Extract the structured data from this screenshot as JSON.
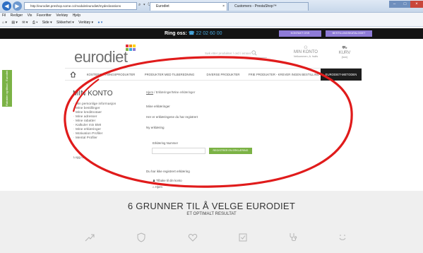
{
  "browser": {
    "address": "http://eurodiet.preshop.some.cc/module/eurodiet/mydeclarations",
    "tabs": [
      {
        "label": "Eurodiet",
        "active": true
      },
      {
        "label": "Customers - PrestaShop™",
        "active": false
      }
    ],
    "menu": [
      "Fil",
      "Rediger",
      "Vis",
      "Favoritter",
      "Verktøy",
      "Hjelp"
    ],
    "commands": [
      "Side ▾",
      "Sikkerhet ▾",
      "Verktøy ▾"
    ]
  },
  "topbar": {
    "ring_label": "Ring oss:",
    "phone": "22 02 60 00",
    "buttons": [
      "KONTAKT OSS",
      "BESTILLINGSKATALOGET"
    ]
  },
  "header": {
    "logo": "eurodiet",
    "search_placeholder": "Søk etter produkter / ord / emner",
    "account_title": "MIN KONTO",
    "account_sub": "Velkommen, A. fsdfs",
    "cart_title": "KURV",
    "cart_sub": "(tom)"
  },
  "side_tab": "Rabatter og tilbud - Eurodiet",
  "nav": [
    "KOSTERSTATNINGSPRODUKTER",
    "PRODUKTER MED TILBEREDNING",
    "DIVERSE PRODUKTER",
    "FRIE PRODUKTER - KREVER INGEN BESTILLING",
    "EURODIET-METODEN"
  ],
  "account_menu": {
    "title": "MIN KONTO",
    "items": [
      "Min personlige informasjon",
      "Mine bestillinger",
      "Mine kreditnotaer",
      "Mine adresser",
      "Mine rabatter",
      "Kalkuler min BMI",
      "Mine erklæringer",
      "Motivation Profiler",
      "Mental Profiler"
    ],
    "logout": "Logg ut"
  },
  "content": {
    "breadcrumb_home": "Hjem",
    "breadcrumb_rest": " / Erklæringer/Mine erklæringer",
    "heading": "Mine erklæringer",
    "intro": "Her er erklæringene du har registrert",
    "new_label": "Ny erklæring",
    "field_label": "Erklæring Nummer",
    "submit_label": "REGISTRER EN ERKLÆRING",
    "empty_msg": "Du har ikke registrert erklæring",
    "back_link": "Tilbake til din konto",
    "home_link": "Hjem"
  },
  "banner": {
    "title": "6 GRUNNER TIL Å VELGE EURODIET",
    "subtitle": "ET OPTIMALT RESULTAT"
  },
  "colors": {
    "brand_green": "#7bb245",
    "annotation_red": "#e01b1b",
    "top_bar": "#141414",
    "phone_blue": "#47a7de",
    "button_purple": "#8e7bd6"
  }
}
